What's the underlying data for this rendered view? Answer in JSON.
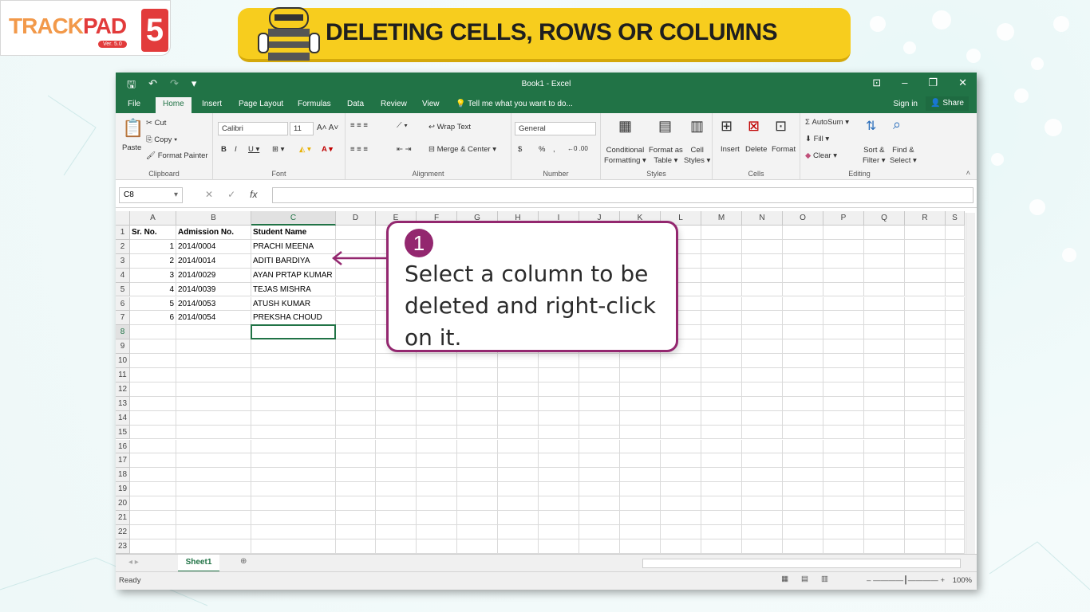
{
  "brand": {
    "name_a": "TRACK",
    "name_b": "PAD",
    "version": "Ver. 5.0",
    "number": "5"
  },
  "banner": {
    "title": "DELETING CELLS, ROWS OR COLUMNS"
  },
  "excel": {
    "window_title": "Book1 - Excel",
    "tabs": [
      {
        "label": "File"
      },
      {
        "label": "Home"
      },
      {
        "label": "Insert"
      },
      {
        "label": "Page Layout"
      },
      {
        "label": "Formulas"
      },
      {
        "label": "Data"
      },
      {
        "label": "Review"
      },
      {
        "label": "View"
      }
    ],
    "tell_me": "Tell me what you want to do...",
    "sign_in": "Sign in",
    "share": "Share",
    "ribbon": {
      "clipboard": {
        "paste": "Paste",
        "cut": "Cut",
        "copy": "Copy",
        "format_painter": "Format Painter",
        "label": "Clipboard"
      },
      "font": {
        "name": "Calibri",
        "size": "11",
        "label": "Font"
      },
      "alignment": {
        "wrap_text": "Wrap Text",
        "merge_center": "Merge & Center",
        "label": "Alignment"
      },
      "number": {
        "format": "General",
        "currency": "$",
        "percent": "%",
        "comma": ",",
        "label": "Number"
      },
      "styles": {
        "conditional": "Conditional",
        "formatting": "Formatting",
        "format_as": "Format as",
        "table": "Table",
        "cell": "Cell",
        "styles": "Styles",
        "label": "Styles"
      },
      "cells": {
        "insert": "Insert",
        "delete": "Delete",
        "format": "Format",
        "label": "Cells"
      },
      "editing": {
        "autosum": "AutoSum",
        "fill": "Fill",
        "clear": "Clear",
        "sort": "Sort &",
        "filter": "Filter",
        "find": "Find &",
        "select": "Select",
        "label": "Editing"
      }
    },
    "name_box": "C8",
    "columns": [
      "A",
      "B",
      "C",
      "D",
      "E",
      "F",
      "G",
      "H",
      "I",
      "J",
      "K",
      "L",
      "M",
      "N",
      "O",
      "P",
      "Q",
      "R",
      "S"
    ],
    "rows": [
      "1",
      "2",
      "3",
      "4",
      "5",
      "6",
      "7",
      "8",
      "9",
      "10",
      "11",
      "12",
      "13",
      "14",
      "15",
      "16",
      "17",
      "18",
      "19",
      "20",
      "21",
      "22",
      "23"
    ],
    "table": {
      "headers": [
        "Sr. No.",
        "Admission No.",
        "Student Name"
      ],
      "records": [
        [
          "1",
          "2014/0004",
          "PRACHI MEENA"
        ],
        [
          "2",
          "2014/0014",
          "ADITI BARDIYA"
        ],
        [
          "3",
          "2014/0029",
          "AYAN PRTAP KUMAR"
        ],
        [
          "4",
          "2014/0039",
          "TEJAS MISHRA"
        ],
        [
          "5",
          "2014/0053",
          "ATUSH KUMAR"
        ],
        [
          "6",
          "2014/0054",
          "PREKSHA CHOUD"
        ]
      ]
    },
    "sheet_tab": "Sheet1",
    "status": "Ready",
    "zoom": "100%"
  },
  "callout": {
    "step": "1",
    "text": "Select a column to be deleted and right-click on it."
  }
}
